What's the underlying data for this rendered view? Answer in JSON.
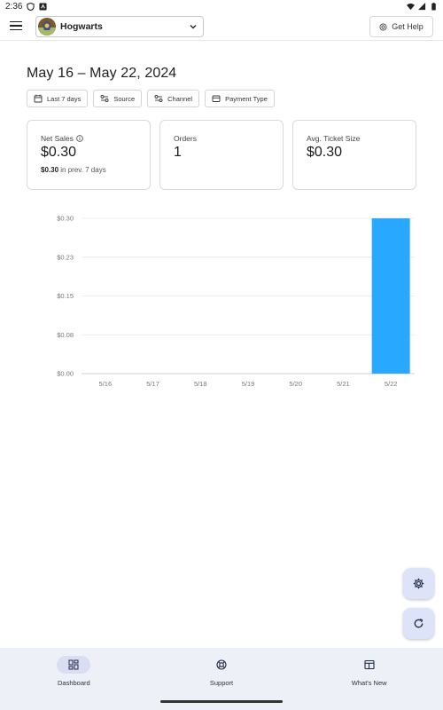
{
  "status_bar": {
    "time": "2:36"
  },
  "app_bar": {
    "location_name": "Hogwarts",
    "help_label": "Get Help"
  },
  "date_range_title": "May 16 – May 22, 2024",
  "filters": [
    {
      "label": "Last 7 days",
      "icon": "calendar-icon"
    },
    {
      "label": "Source",
      "icon": "source-icon"
    },
    {
      "label": "Channel",
      "icon": "channel-icon"
    },
    {
      "label": "Payment Type",
      "icon": "card-icon"
    }
  ],
  "cards": {
    "net_sales": {
      "title": "Net Sales",
      "value": "$0.30",
      "prev_value": "$0.30",
      "prev_suffix": " in prev. 7 days"
    },
    "orders": {
      "title": "Orders",
      "value": "1"
    },
    "avg_ticket": {
      "title": "Avg. Ticket Size",
      "value": "$0.30"
    }
  },
  "chart_data": {
    "type": "bar",
    "categories": [
      "5/16",
      "5/17",
      "5/18",
      "5/19",
      "5/20",
      "5/21",
      "5/22"
    ],
    "values": [
      0,
      0,
      0,
      0,
      0,
      0,
      0.3
    ],
    "y_ticks": [
      "$0.00",
      "$0.08",
      "$0.15",
      "$0.23",
      "$0.30"
    ],
    "ylim": [
      0,
      0.3
    ],
    "grid": true,
    "bar_color": "#29a8ff"
  },
  "bottom_nav": [
    {
      "label": "Dashboard",
      "active": true
    },
    {
      "label": "Support",
      "active": false
    },
    {
      "label": "What's New",
      "active": false
    }
  ],
  "colors": {
    "accent_bar": "#29a8ff",
    "fab_bg": "#dde3f8",
    "nav_bg": "#eef0f8"
  }
}
